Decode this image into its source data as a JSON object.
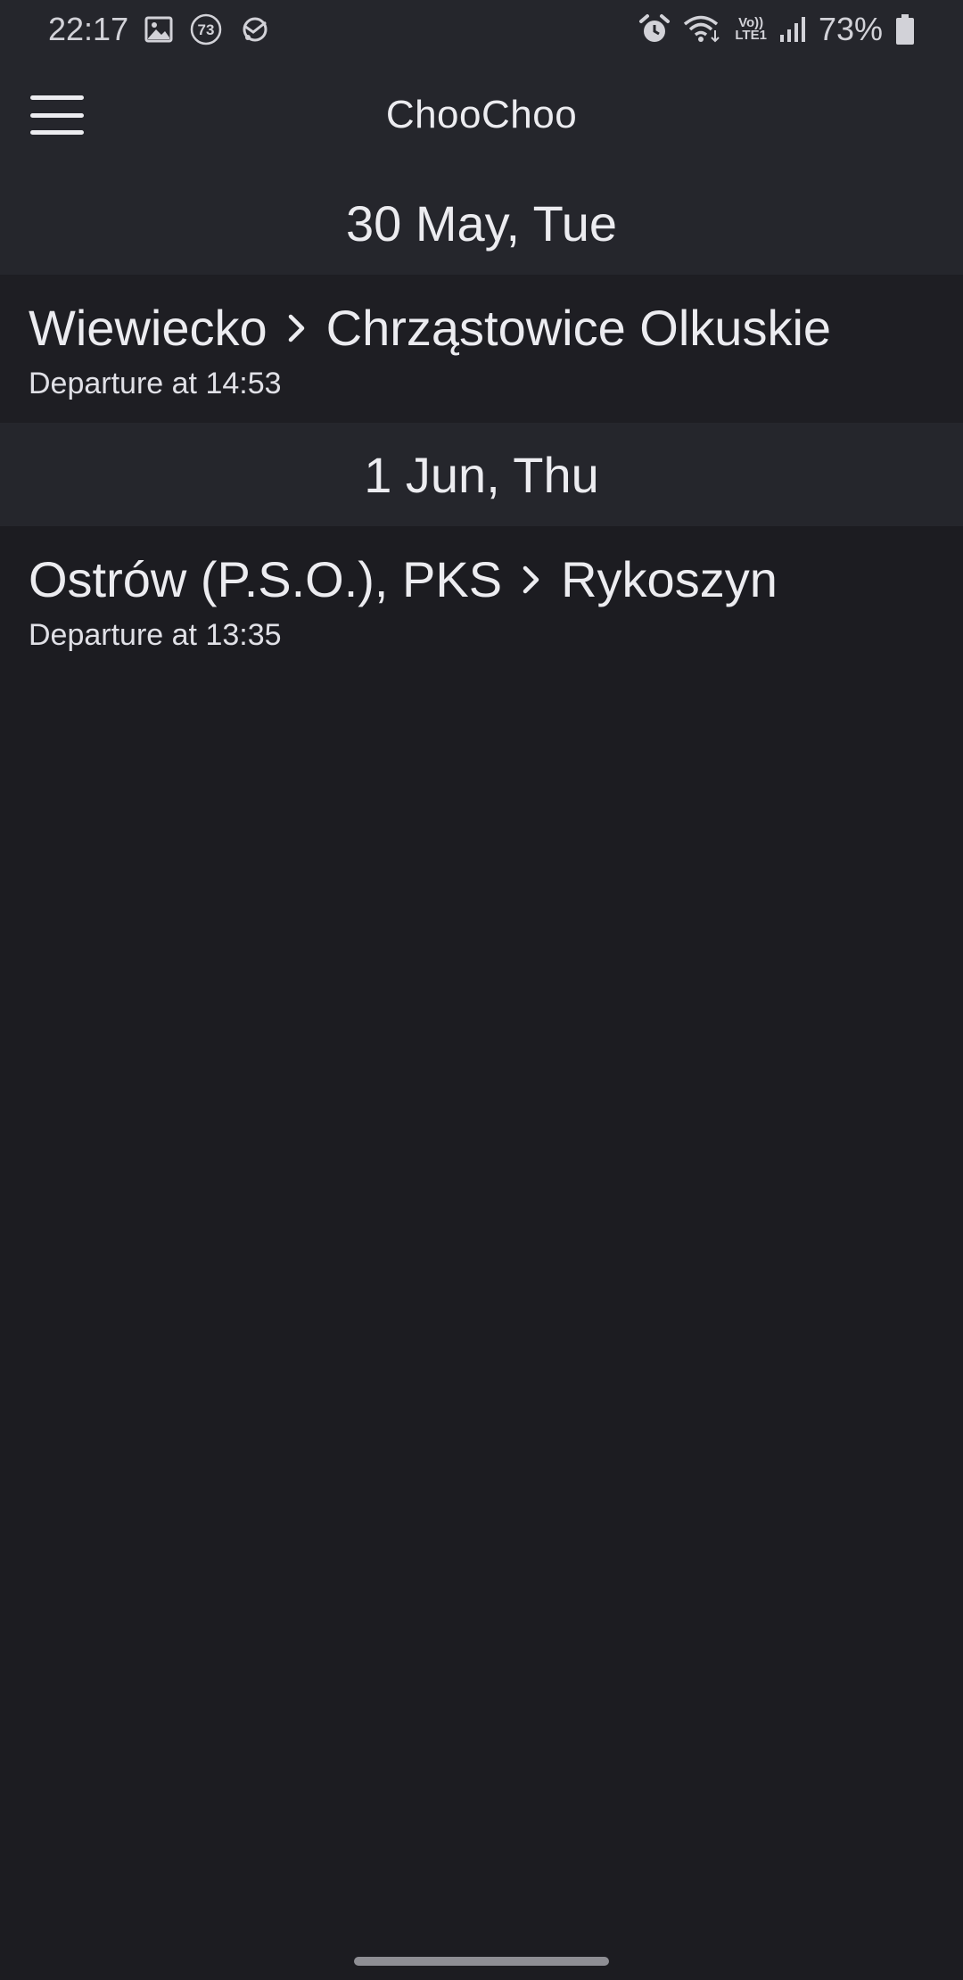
{
  "status_bar": {
    "time": "22:17",
    "notification_badge": "73",
    "battery_percent": "73%",
    "network_top": "Vo))",
    "network_bottom": "LTE1",
    "left_icons": [
      "image-icon",
      "badge-73-icon",
      "sync-icon"
    ],
    "right_icons": [
      "alarm-icon",
      "wifi-icon",
      "volte-icon",
      "signal-icon",
      "battery-icon"
    ]
  },
  "app_bar": {
    "title": "ChooChoo",
    "menu_icon": "hamburger-menu-icon"
  },
  "sections": [
    {
      "date": "30 May, Tue",
      "trips": [
        {
          "from": "Wiewiecko",
          "to": "Chrząstowice Olkuskie",
          "departure": "Departure at 14:53"
        }
      ]
    },
    {
      "date": "1 Jun, Thu",
      "trips": [
        {
          "from": "Ostrów (P.S.O.), PKS",
          "to": "Rykoszyn",
          "departure": "Departure at 13:35"
        }
      ]
    }
  ],
  "colors": {
    "background": "#1c1c21",
    "header_background": "#25262c",
    "text": "#ececf0"
  }
}
